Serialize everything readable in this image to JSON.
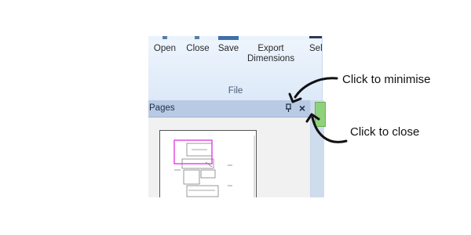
{
  "ribbon": {
    "buttons": [
      {
        "label": "Open"
      },
      {
        "label": "Close"
      },
      {
        "label": "Save"
      },
      {
        "label": "Export Dimensions"
      },
      {
        "label": "Sele"
      }
    ],
    "group_label": "File"
  },
  "pages_panel": {
    "title": "Pages",
    "pin_glyph": "ᴩ8",
    "close_glyph": "×",
    "pin_icon": "pin-icon",
    "close_icon": "close-icon"
  },
  "callouts": {
    "minimise": "Click to minimise",
    "close": "Click to close"
  },
  "colors": {
    "ribbon_bg": "#dde9f8",
    "panel_header": "#b9cbe4",
    "thumbnail_highlight": "#e040e0",
    "green_tab": "#8fd27c"
  }
}
